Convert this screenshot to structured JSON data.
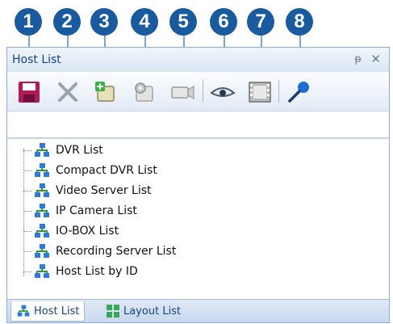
{
  "callouts": [
    "1",
    "2",
    "3",
    "4",
    "5",
    "6",
    "7",
    "8"
  ],
  "panel": {
    "title": "Host List",
    "pin_glyph": "ᵽ",
    "close_glyph": "✕"
  },
  "toolbar": {
    "buttons": [
      {
        "icon": "save-icon"
      },
      {
        "icon": "delete-icon"
      },
      {
        "icon": "add-device-icon"
      },
      {
        "icon": "settings-device-icon"
      },
      {
        "icon": "camera-icon"
      },
      {
        "icon": "eye-icon"
      },
      {
        "icon": "film-icon"
      },
      {
        "icon": "microphone-icon"
      }
    ]
  },
  "search": {
    "value": "",
    "placeholder": ""
  },
  "tree": {
    "items": [
      {
        "label": "DVR List"
      },
      {
        "label": "Compact DVR List"
      },
      {
        "label": "Video Server List"
      },
      {
        "label": "IP Camera List"
      },
      {
        "label": "IO-BOX List"
      },
      {
        "label": "Recording Server List"
      },
      {
        "label": "Host List by ID"
      }
    ]
  },
  "tabs": [
    {
      "label": "Host List",
      "active": true
    },
    {
      "label": "Layout List",
      "active": false
    }
  ],
  "colors": {
    "badge": "#1a5a9e",
    "panel_border": "#8aaed8",
    "title_text": "#15428b"
  }
}
